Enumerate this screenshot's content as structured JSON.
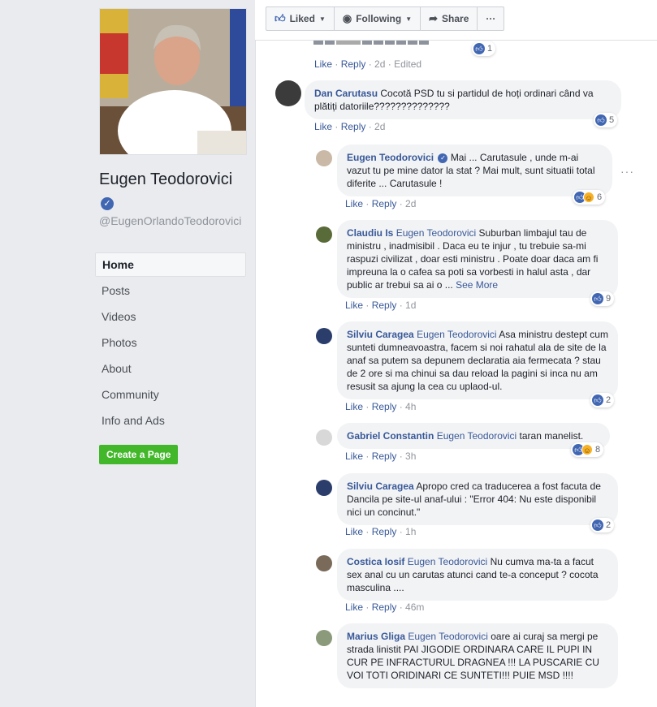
{
  "page": {
    "name": "Eugen Teodorovici",
    "handle": "@EugenOrlandoTeodorovici"
  },
  "nav": {
    "items": [
      "Home",
      "Posts",
      "Videos",
      "Photos",
      "About",
      "Community",
      "Info and Ads"
    ],
    "create_page": "Create a Page"
  },
  "toolbar": {
    "liked": "Liked",
    "following": "Following",
    "share": "Share",
    "more": "···"
  },
  "top_comment_tail": {
    "actions": {
      "like": "Like",
      "reply": "Reply",
      "time": "2d",
      "edited": "Edited"
    },
    "reactions": "1"
  },
  "comments": [
    {
      "author": "Dan Carutasu",
      "tag": "",
      "text": "Cocotă PSD tu si partidul de hoți ordinari când va plătiți datoriile??????????????",
      "time": "2d",
      "reactions": "5"
    },
    {
      "author": "Eugen Teodorovici",
      "tag": "",
      "text": "Mai ... Carutasule , unde m-ai vazut tu pe mine dator la stat ? Mai mult, sunt situatii total diferite ... Carutasule !",
      "time": "2d",
      "reactions": "6"
    },
    {
      "author": "Claudiu Is",
      "tag": "Eugen Teodorovici",
      "text": "Suburban limbajul tau de ministru , inadmisibil . Daca eu te injur , tu trebuie sa-mi raspuzi civilizat , doar esti ministru . Poate doar daca am fi impreuna la o cafea sa poti sa vorbesti in halul asta , dar public ar trebui sa ai o ...",
      "see_more": "See More",
      "time": "1d",
      "reactions": "9"
    },
    {
      "author": "Silviu Caragea",
      "tag": "Eugen Teodorovici",
      "text": "Asa ministru destept cum sunteti dumneavoastra, facem si noi rahatul ala de site de la anaf sa putem sa depunem declaratia aia fermecata ? stau de 2 ore si ma chinui sa dau reload la pagini si inca nu am resusit sa ajung la cea cu uplaod-ul.",
      "time": "4h",
      "reactions": "2"
    },
    {
      "author": "Gabriel Constantin",
      "tag": "Eugen Teodorovici",
      "text": "taran manelist.",
      "time": "3h",
      "reactions": "8"
    },
    {
      "author": "Silviu Caragea",
      "tag": "",
      "text": "Apropo cred ca traducerea a fost facuta de Dancila pe site-ul anaf-ului : \"Error 404: Nu este disponibil nici un concinut.\"",
      "time": "1h",
      "reactions": "2"
    },
    {
      "author": "Costica Iosif",
      "tag": "Eugen Teodorovici",
      "text": "Nu cumva ma-ta a facut sex anal cu un carutas atunci cand te-a conceput ? cocota masculina ....",
      "time": "46m",
      "reactions": ""
    },
    {
      "author": "Marius Gliga",
      "tag": "Eugen Teodorovici",
      "text": "oare ai curaj sa mergi pe strada linistit PAI JIGODIE ORDINARA CARE IL PUPI IN CUR PE INFRACTURUL DRAGNEA !!! LA PUSCARIE CU VOI TOTI ORIDINARI CE SUNTETI!!! PUIE MSD !!!!",
      "time": "",
      "reactions": ""
    }
  ],
  "labels": {
    "like": "Like",
    "reply": "Reply"
  },
  "colors": {
    "link": "#385898",
    "like_blue": "#4267b2",
    "create_green": "#42b72a"
  }
}
